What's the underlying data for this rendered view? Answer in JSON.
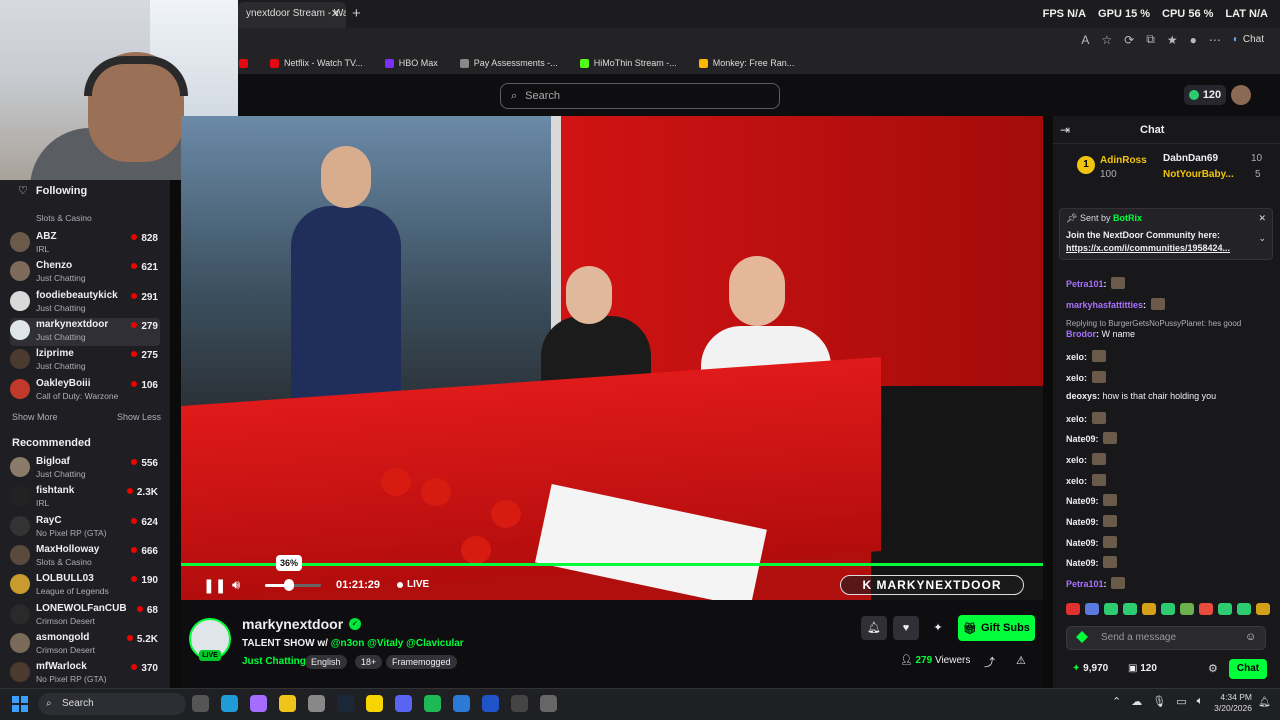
{
  "browser": {
    "tab_title": "ynextdoor Stream - Watc",
    "tab_close": "✕",
    "new_tab": "+",
    "perf": {
      "fps_label": "FPS",
      "fps": "N/A",
      "gpu_label": "GPU",
      "gpu": "15 %",
      "cpu_label": "CPU",
      "cpu": "56 %",
      "lat_label": "LAT",
      "lat": "N/A"
    },
    "copilot_label": "Chat",
    "bookmarks": [
      {
        "label": "Netflix - Watch TV...",
        "color": "#e50914"
      },
      {
        "label": "HBO Max",
        "color": "#7b2ff7"
      },
      {
        "label": "Pay Assessments -...",
        "color": "#888888"
      },
      {
        "label": "HiMoThin Stream -...",
        "color": "#53fc18"
      },
      {
        "label": "Monkey: Free Ran...",
        "color": "#ffb400"
      }
    ]
  },
  "topnav": {
    "search_placeholder": "Search",
    "bits": "120"
  },
  "sidebar": {
    "following_title": "Following",
    "partial_first_category": "Slots & Casino",
    "following": [
      {
        "name": "ABZ",
        "category": "IRL",
        "viewers": "828",
        "color": "#6b5a4a"
      },
      {
        "name": "Chenzo",
        "category": "Just Chatting",
        "viewers": "621",
        "color": "#7d6a5a"
      },
      {
        "name": "foodiebeautykick",
        "category": "Just Chatting",
        "viewers": "291",
        "color": "#d9d9d9"
      },
      {
        "name": "markynextdoor",
        "category": "Just Chatting",
        "viewers": "279",
        "color": "#dfe5e8"
      },
      {
        "name": "lziprime",
        "category": "Just Chatting",
        "viewers": "275",
        "color": "#4b3a30"
      },
      {
        "name": "OakleyBoiii",
        "category": "Call of Duty: Warzone",
        "viewers": "106",
        "color": "#c0392b"
      }
    ],
    "show_more": "Show More",
    "show_less": "Show Less",
    "recommended_title": "Recommended",
    "recommended": [
      {
        "name": "Bigloaf",
        "category": "Just Chatting",
        "viewers": "556",
        "color": "#8a7a6a"
      },
      {
        "name": "fishtank",
        "category": "IRL",
        "viewers": "2.3K",
        "color": "#222222"
      },
      {
        "name": "RayC",
        "category": "No Pixel RP (GTA)",
        "viewers": "624",
        "color": "#333333"
      },
      {
        "name": "MaxHolloway",
        "category": "Slots & Casino",
        "viewers": "666",
        "color": "#5a4a3e"
      },
      {
        "name": "LOLBULL03",
        "category": "League of Legends",
        "viewers": "190",
        "color": "#c99a2e"
      },
      {
        "name": "LONEWOLFanCUB",
        "category": "Crimson Desert",
        "viewers": "68",
        "color": "#2a2a2a"
      },
      {
        "name": "asmongold",
        "category": "Crimson Desert",
        "viewers": "5.2K",
        "color": "#7a6a5a"
      },
      {
        "name": "mfWarlock",
        "category": "No Pixel RP (GTA)",
        "viewers": "370",
        "color": "#4a3b2e"
      }
    ]
  },
  "player": {
    "volume_percent": 36,
    "volume_tip": "36%",
    "time": "01:21:29",
    "live_label": "LIVE",
    "watermark": "K MARKYNEXTDOOR",
    "progress": 1.0
  },
  "channel": {
    "name": "markynextdoor",
    "live_badge": "LIVE",
    "title_prefix": "TALENT SHOW w/",
    "mentions": "@n3on @Vitaly @Clavicular",
    "category": "Just Chatting",
    "tags": [
      "English",
      "18+",
      "Framemogged"
    ],
    "gift_subs": "Gift Subs",
    "viewers": "279",
    "viewers_label": "Viewers"
  },
  "chat": {
    "title": "Chat",
    "leaderboard": [
      {
        "name": "AdinRoss",
        "amount": "100"
      },
      {
        "name": "DabnDan69",
        "amount": "10"
      },
      {
        "name": "NotYourBaby...",
        "amount": "5"
      }
    ],
    "pinned_sender_prefix": "Sent by",
    "pinned_sender": "BotRix",
    "pinned_text": "Join the NextDoor Community here:",
    "pinned_link": "https://x.com/i/communities/1958424...",
    "reply_note": "Replying to BurgerGetsNoPussyPlanet: hes good",
    "messages": [
      {
        "user": "Petra101",
        "text": "",
        "color": "#a970ff"
      },
      {
        "user": "markyhasfattitties",
        "text": "",
        "color": "#a970ff"
      },
      {
        "user": "Brodor",
        "text": "W name",
        "color": "#a970ff"
      },
      {
        "user": "xelo",
        "text": "",
        "color": "#efeff1"
      },
      {
        "user": "xelo",
        "text": "",
        "color": "#efeff1"
      },
      {
        "user": "deoxys",
        "text": "how is that chair holding you",
        "color": "#efeff1"
      },
      {
        "user": "xelo",
        "text": "",
        "color": "#efeff1"
      },
      {
        "user": "Nate09",
        "text": "",
        "color": "#efeff1"
      },
      {
        "user": "xelo",
        "text": "",
        "color": "#efeff1"
      },
      {
        "user": "xelo",
        "text": "",
        "color": "#efeff1"
      },
      {
        "user": "Nate09",
        "text": "",
        "color": "#efeff1"
      },
      {
        "user": "Nate09",
        "text": "",
        "color": "#efeff1"
      },
      {
        "user": "Nate09",
        "text": "",
        "color": "#efeff1"
      },
      {
        "user": "Nate09",
        "text": "",
        "color": "#efeff1"
      },
      {
        "user": "Petra101",
        "text": "",
        "color": "#a970ff"
      }
    ],
    "input_placeholder": "Send a message",
    "points": "9,970",
    "points2": "120",
    "send_label": "Chat"
  },
  "taskbar": {
    "search_label": "Search",
    "time": "4:34 PM",
    "date": "3/20/2026"
  },
  "colors": {
    "accent": "#00ff3a",
    "bg": "#0e0e10",
    "live": "#eb0400"
  }
}
